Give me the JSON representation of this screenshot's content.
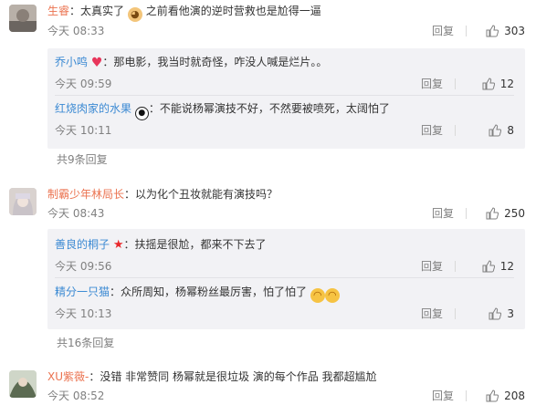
{
  "common": {
    "reply_label": "回复"
  },
  "comments": [
    {
      "user": "生睿",
      "text_a": "：太真实了",
      "text_b": "  之前看他演的逆时营救也是尬得一逼",
      "time": "今天 08:33",
      "likes": "303",
      "replies": [
        {
          "user": "乔小鸣",
          "text": "：那电影，我当时就奇怪，咋没人喊是烂片。。",
          "time": "今天 09:59",
          "likes": "12"
        },
        {
          "user": "红烧肉家的水果",
          "text": "：不能说杨幂演技不好，不然要被喷死，太阔怕了",
          "time": "今天 10:11",
          "likes": "8"
        }
      ],
      "more": "共9条回复"
    },
    {
      "user": "制霸少年林局长",
      "text_a": "：以为化个丑妆就能有演技吗？",
      "time": "今天 08:43",
      "likes": "250",
      "replies": [
        {
          "user": "善良的桐子",
          "text": "：扶摇是很尬，都来不下去了",
          "time": "今天 09:56",
          "likes": "12"
        },
        {
          "user": "精分一只猫",
          "text": "：众所周知，杨幂粉丝最厉害，怕了怕了",
          "time": "今天 10:13",
          "likes": "3"
        }
      ],
      "more": "共16条回复"
    },
    {
      "user": "XU紫薇-",
      "text_a": "：没错  非常赞同   杨幂就是很垃圾   演的每个作品  我都超尴尬",
      "time": "今天 08:52",
      "likes": "208"
    }
  ],
  "colors": {
    "username": "#eb7350",
    "reply_name": "#3c8ad3",
    "sub_bg": "#f2f2f5"
  }
}
